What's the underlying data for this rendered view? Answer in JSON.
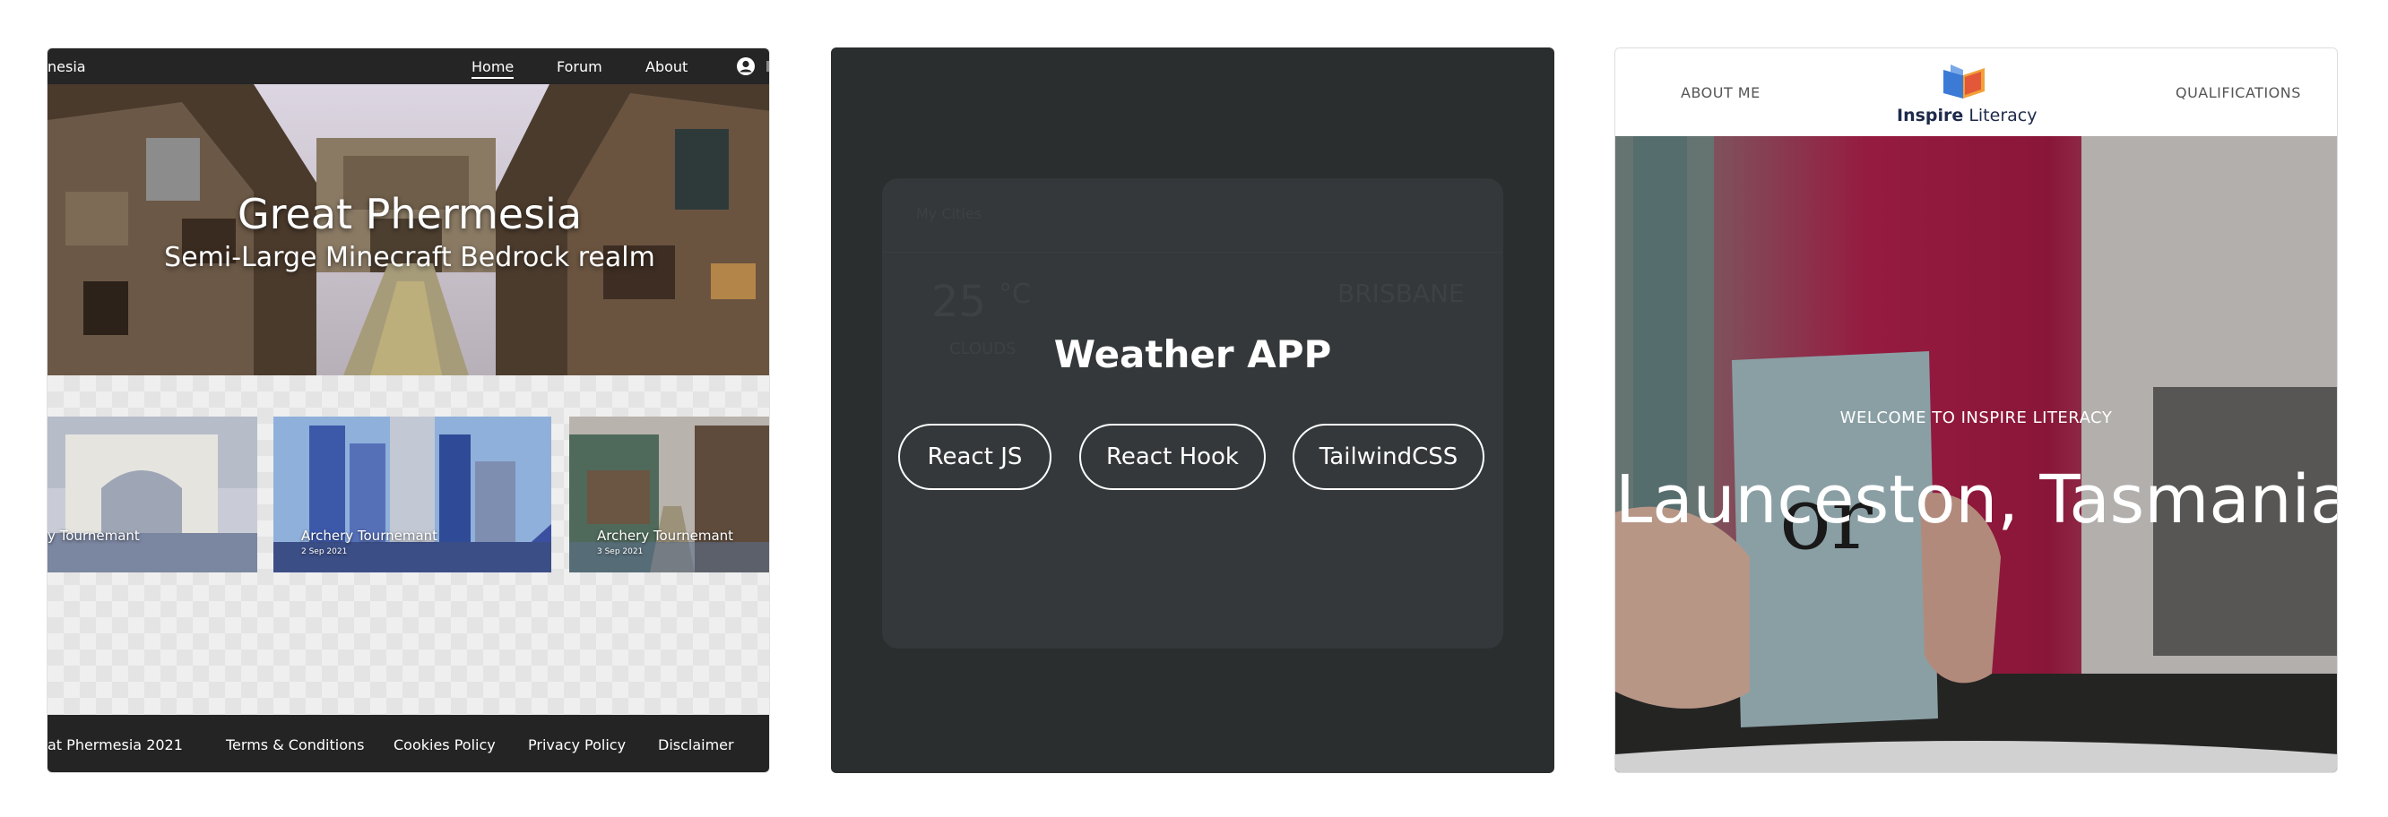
{
  "card1": {
    "nav": {
      "brand": "nesia",
      "items": [
        {
          "label": "Home",
          "active": true
        },
        {
          "label": "Forum",
          "active": false
        },
        {
          "label": "About",
          "active": false
        }
      ],
      "user_icon": "user-circle-icon"
    },
    "hero": {
      "title": "Great Phermesia",
      "subtitle": "Semi-Large Minecraft Bedrock realm"
    },
    "tiles": [
      {
        "title": "y Tournemant",
        "date": ""
      },
      {
        "title": "Archery Tournemant",
        "date": "2 Sep 2021"
      },
      {
        "title": "Archery Tournemant",
        "date": "3 Sep 2021"
      }
    ],
    "footer": {
      "copyright": "at Phermesia 2021",
      "links": [
        "Terms & Conditions",
        "Cookies Policy",
        "Privacy Policy",
        "Disclaimer"
      ]
    }
  },
  "card2": {
    "title": "Weather APP",
    "tags": [
      "React JS",
      "React Hook",
      "TailwindCSS"
    ],
    "background": {
      "header": "My Cities",
      "temperature": "25",
      "unit": "°C",
      "city": "BRISBANE",
      "condition": "CLOUDS"
    }
  },
  "card3": {
    "nav": {
      "left": "ABOUT ME",
      "right": "QUALIFICATIONS",
      "logo_word1": "Inspire",
      "logo_word2": " Literacy"
    },
    "hero": {
      "eyebrow": "WELCOME TO INSPIRE LITERACY",
      "headline": "Launceston, Tasmania.",
      "card_text": "or"
    }
  },
  "colors": {
    "dark_nav": "#252525",
    "weather_bg": "#2b2e2f",
    "logo_blue": "#3b7bd6",
    "logo_orange": "#f2a13a",
    "logo_red": "#e04b3a",
    "logo_navy": "#1d2a4a"
  }
}
